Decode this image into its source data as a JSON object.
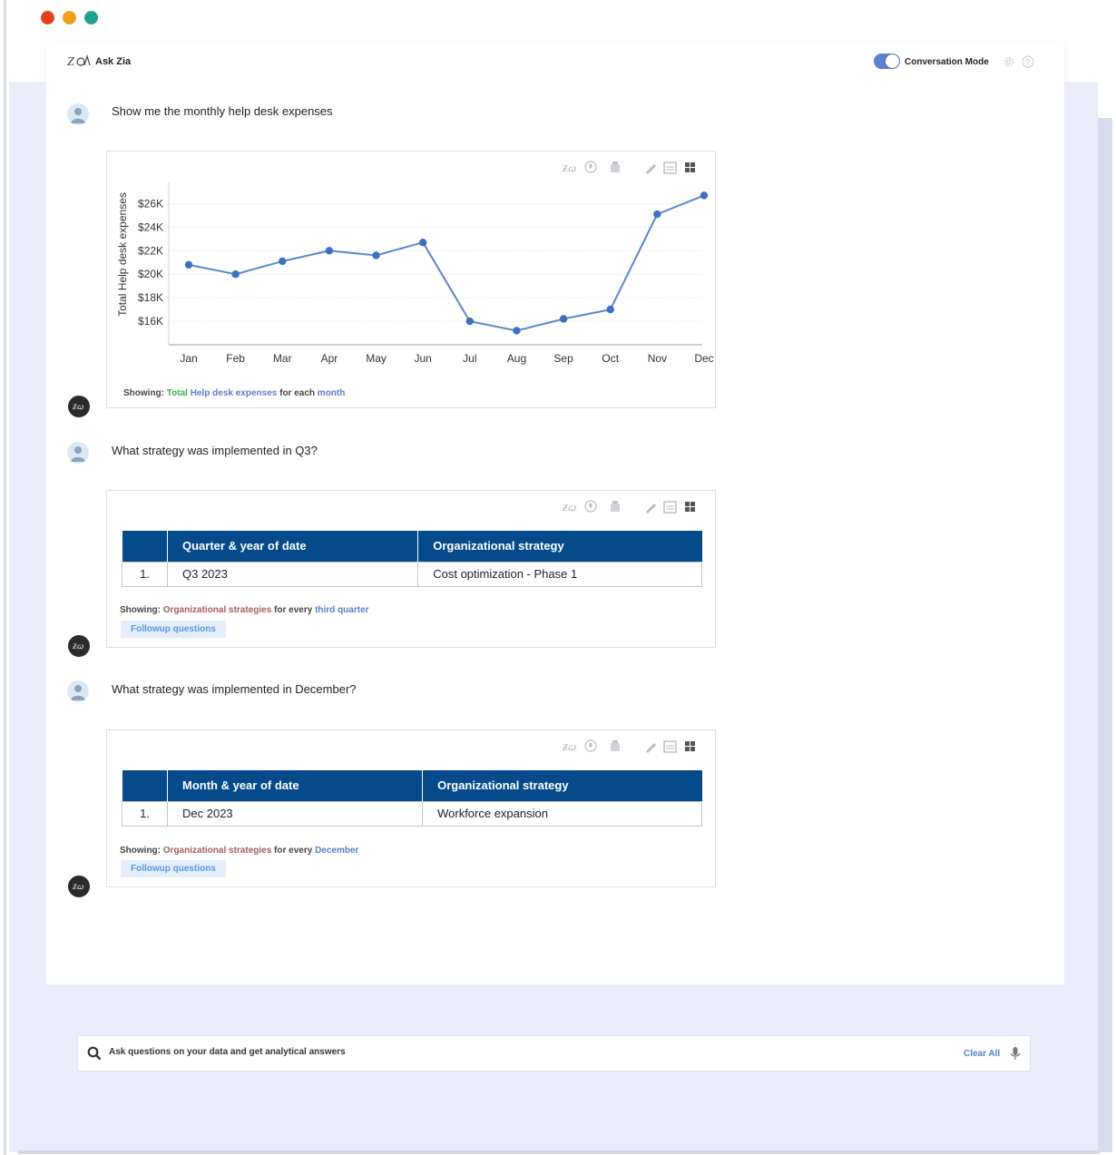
{
  "window": {
    "dots": [
      "#e0421e",
      "#f0a020",
      "#1fa48f"
    ]
  },
  "header": {
    "title": "Ask Zia",
    "conversation_mode_label": "Conversation Mode",
    "conversation_mode_on": true
  },
  "conversation": [
    {
      "question": "Show me the monthly help desk expenses",
      "answer_type": "chart",
      "showing": {
        "prefix": "Showing:",
        "agg": "Total",
        "measure": "Help desk expenses",
        "connector": "for each",
        "dimension": "month"
      }
    },
    {
      "question": "What strategy was implemented in Q3?",
      "answer_type": "table",
      "table": {
        "columns": [
          "",
          "Quarter & year of date",
          "Organizational strategy"
        ],
        "rows": [
          [
            "1.",
            "Q3 2023",
            "Cost optimization - Phase 1"
          ]
        ]
      },
      "showing": {
        "prefix": "Showing:",
        "measure": "Organizational strategies",
        "connector": "for every",
        "dimension": "third quarter"
      },
      "followup_label": "Followup questions"
    },
    {
      "question": "What strategy was implemented in December?",
      "answer_type": "table",
      "table": {
        "columns": [
          "",
          "Month & year of date",
          "Organizational strategy"
        ],
        "rows": [
          [
            "1.",
            "Dec 2023",
            "Workforce expansion"
          ]
        ]
      },
      "showing": {
        "prefix": "Showing:",
        "measure": "Organizational strategies",
        "connector": "for every",
        "dimension": "December"
      },
      "followup_label": "Followup questions"
    }
  ],
  "chart_data": {
    "type": "line",
    "categories": [
      "Jan",
      "Feb",
      "Mar",
      "Apr",
      "May",
      "Jun",
      "Jul",
      "Aug",
      "Sep",
      "Oct",
      "Nov",
      "Dec"
    ],
    "series": [
      {
        "values": [
          20800,
          20000,
          21100,
          22000,
          21600,
          22700,
          16000,
          15200,
          16200,
          17000,
          25100,
          26700
        ]
      }
    ],
    "title": "",
    "xlabel": "",
    "ylabel": "Total Help desk expenses",
    "yticks": [
      16000,
      18000,
      20000,
      22000,
      24000,
      26000
    ],
    "ytick_labels": [
      "$16K",
      "$18K",
      "$20K",
      "$22K",
      "$24K",
      "$26K"
    ],
    "ylim": [
      14000,
      27500
    ],
    "grid": true,
    "line_color": "#5d86c8",
    "marker_color": "#3e6fc0"
  },
  "search": {
    "placeholder": "Ask questions on your data and get analytical answers",
    "clear_label": "Clear All"
  },
  "icons": {
    "logo": "zia-logo-icon",
    "settings": "gear-icon",
    "help": "help-icon",
    "search": "search-icon",
    "mic": "mic-icon"
  }
}
